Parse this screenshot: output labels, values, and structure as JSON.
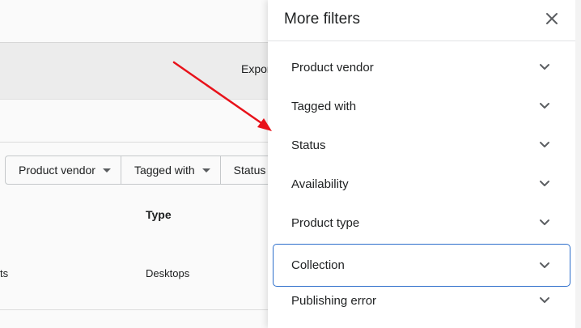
{
  "background": {
    "export_label": "Expor",
    "filter_buttons": [
      {
        "label": "Product vendor",
        "has_caret": true
      },
      {
        "label": "Tagged with",
        "has_caret": true
      },
      {
        "label": "Status",
        "has_caret": false
      }
    ],
    "column_type": "Type",
    "row": {
      "left_text": "ts",
      "type": "Desktops"
    }
  },
  "panel": {
    "title": "More filters",
    "close_icon": "close-icon",
    "items": [
      {
        "label": "Product vendor",
        "focused": false
      },
      {
        "label": "Tagged with",
        "focused": false
      },
      {
        "label": "Status",
        "focused": false
      },
      {
        "label": "Availability",
        "focused": false
      },
      {
        "label": "Product type",
        "focused": false
      },
      {
        "label": "Collection",
        "focused": true
      },
      {
        "label": "Publishing error",
        "focused": false
      }
    ]
  },
  "colors": {
    "annotation_arrow": "#e8121a",
    "focus_border": "#2c6ecb",
    "text": "#202223"
  }
}
